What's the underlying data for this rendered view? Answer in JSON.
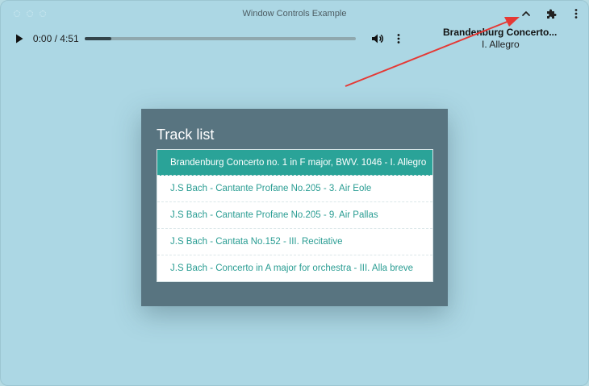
{
  "window": {
    "title": "Window Controls Example"
  },
  "titlebar_icons": [
    "chevron-up-icon",
    "puzzle-icon",
    "more-vertical-icon"
  ],
  "player": {
    "time": "0:00 / 4:51",
    "progress_fraction": 0.1
  },
  "now_playing": {
    "title": "Brandenburg Concerto...",
    "subtitle": "I. Allegro"
  },
  "tracklist": {
    "heading": "Track list",
    "tracks": [
      {
        "label": "Brandenburg Concerto no. 1 in F major, BWV. 1046 - I. Allegro",
        "active": true
      },
      {
        "label": "J.S Bach - Cantante Profane No.205 - 3. Air Eole",
        "active": false
      },
      {
        "label": "J.S Bach - Cantante Profane No.205 - 9. Air Pallas",
        "active": false
      },
      {
        "label": "J.S Bach - Cantata No.152 - III. Recitative",
        "active": false
      },
      {
        "label": "J.S Bach - Concerto in A major for orchestra - III. Alla breve",
        "active": false
      }
    ]
  },
  "colors": {
    "background": "#acd7e4",
    "card": "#587480",
    "active_track": "#2aa398",
    "track_text": "#2a9d93",
    "annotation_arrow": "#e53935"
  }
}
